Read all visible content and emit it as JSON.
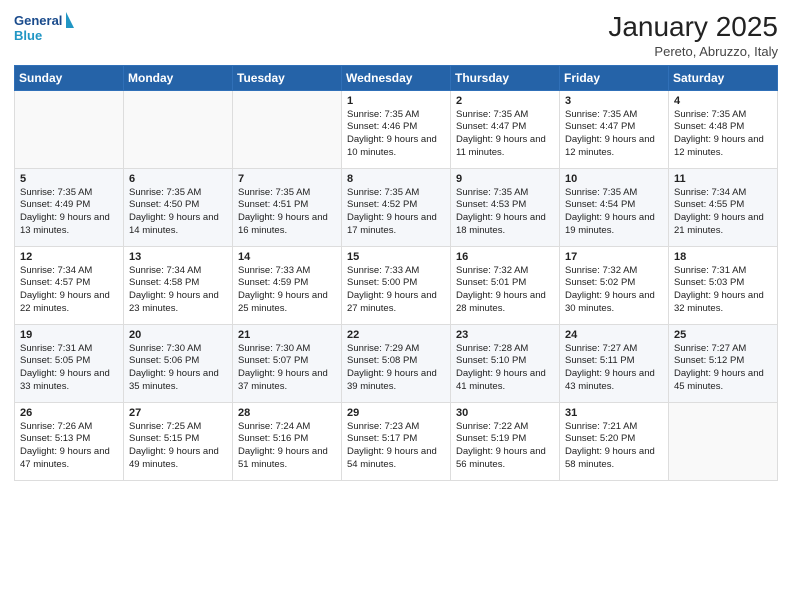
{
  "header": {
    "logo_line1": "General",
    "logo_line2": "Blue",
    "month": "January 2025",
    "location": "Pereto, Abruzzo, Italy"
  },
  "weekdays": [
    "Sunday",
    "Monday",
    "Tuesday",
    "Wednesday",
    "Thursday",
    "Friday",
    "Saturday"
  ],
  "weeks": [
    [
      {
        "day": "",
        "sunrise": "",
        "sunset": "",
        "daylight": ""
      },
      {
        "day": "",
        "sunrise": "",
        "sunset": "",
        "daylight": ""
      },
      {
        "day": "",
        "sunrise": "",
        "sunset": "",
        "daylight": ""
      },
      {
        "day": "1",
        "sunrise": "Sunrise: 7:35 AM",
        "sunset": "Sunset: 4:46 PM",
        "daylight": "Daylight: 9 hours and 10 minutes."
      },
      {
        "day": "2",
        "sunrise": "Sunrise: 7:35 AM",
        "sunset": "Sunset: 4:47 PM",
        "daylight": "Daylight: 9 hours and 11 minutes."
      },
      {
        "day": "3",
        "sunrise": "Sunrise: 7:35 AM",
        "sunset": "Sunset: 4:47 PM",
        "daylight": "Daylight: 9 hours and 12 minutes."
      },
      {
        "day": "4",
        "sunrise": "Sunrise: 7:35 AM",
        "sunset": "Sunset: 4:48 PM",
        "daylight": "Daylight: 9 hours and 12 minutes."
      }
    ],
    [
      {
        "day": "5",
        "sunrise": "Sunrise: 7:35 AM",
        "sunset": "Sunset: 4:49 PM",
        "daylight": "Daylight: 9 hours and 13 minutes."
      },
      {
        "day": "6",
        "sunrise": "Sunrise: 7:35 AM",
        "sunset": "Sunset: 4:50 PM",
        "daylight": "Daylight: 9 hours and 14 minutes."
      },
      {
        "day": "7",
        "sunrise": "Sunrise: 7:35 AM",
        "sunset": "Sunset: 4:51 PM",
        "daylight": "Daylight: 9 hours and 16 minutes."
      },
      {
        "day": "8",
        "sunrise": "Sunrise: 7:35 AM",
        "sunset": "Sunset: 4:52 PM",
        "daylight": "Daylight: 9 hours and 17 minutes."
      },
      {
        "day": "9",
        "sunrise": "Sunrise: 7:35 AM",
        "sunset": "Sunset: 4:53 PM",
        "daylight": "Daylight: 9 hours and 18 minutes."
      },
      {
        "day": "10",
        "sunrise": "Sunrise: 7:35 AM",
        "sunset": "Sunset: 4:54 PM",
        "daylight": "Daylight: 9 hours and 19 minutes."
      },
      {
        "day": "11",
        "sunrise": "Sunrise: 7:34 AM",
        "sunset": "Sunset: 4:55 PM",
        "daylight": "Daylight: 9 hours and 21 minutes."
      }
    ],
    [
      {
        "day": "12",
        "sunrise": "Sunrise: 7:34 AM",
        "sunset": "Sunset: 4:57 PM",
        "daylight": "Daylight: 9 hours and 22 minutes."
      },
      {
        "day": "13",
        "sunrise": "Sunrise: 7:34 AM",
        "sunset": "Sunset: 4:58 PM",
        "daylight": "Daylight: 9 hours and 23 minutes."
      },
      {
        "day": "14",
        "sunrise": "Sunrise: 7:33 AM",
        "sunset": "Sunset: 4:59 PM",
        "daylight": "Daylight: 9 hours and 25 minutes."
      },
      {
        "day": "15",
        "sunrise": "Sunrise: 7:33 AM",
        "sunset": "Sunset: 5:00 PM",
        "daylight": "Daylight: 9 hours and 27 minutes."
      },
      {
        "day": "16",
        "sunrise": "Sunrise: 7:32 AM",
        "sunset": "Sunset: 5:01 PM",
        "daylight": "Daylight: 9 hours and 28 minutes."
      },
      {
        "day": "17",
        "sunrise": "Sunrise: 7:32 AM",
        "sunset": "Sunset: 5:02 PM",
        "daylight": "Daylight: 9 hours and 30 minutes."
      },
      {
        "day": "18",
        "sunrise": "Sunrise: 7:31 AM",
        "sunset": "Sunset: 5:03 PM",
        "daylight": "Daylight: 9 hours and 32 minutes."
      }
    ],
    [
      {
        "day": "19",
        "sunrise": "Sunrise: 7:31 AM",
        "sunset": "Sunset: 5:05 PM",
        "daylight": "Daylight: 9 hours and 33 minutes."
      },
      {
        "day": "20",
        "sunrise": "Sunrise: 7:30 AM",
        "sunset": "Sunset: 5:06 PM",
        "daylight": "Daylight: 9 hours and 35 minutes."
      },
      {
        "day": "21",
        "sunrise": "Sunrise: 7:30 AM",
        "sunset": "Sunset: 5:07 PM",
        "daylight": "Daylight: 9 hours and 37 minutes."
      },
      {
        "day": "22",
        "sunrise": "Sunrise: 7:29 AM",
        "sunset": "Sunset: 5:08 PM",
        "daylight": "Daylight: 9 hours and 39 minutes."
      },
      {
        "day": "23",
        "sunrise": "Sunrise: 7:28 AM",
        "sunset": "Sunset: 5:10 PM",
        "daylight": "Daylight: 9 hours and 41 minutes."
      },
      {
        "day": "24",
        "sunrise": "Sunrise: 7:27 AM",
        "sunset": "Sunset: 5:11 PM",
        "daylight": "Daylight: 9 hours and 43 minutes."
      },
      {
        "day": "25",
        "sunrise": "Sunrise: 7:27 AM",
        "sunset": "Sunset: 5:12 PM",
        "daylight": "Daylight: 9 hours and 45 minutes."
      }
    ],
    [
      {
        "day": "26",
        "sunrise": "Sunrise: 7:26 AM",
        "sunset": "Sunset: 5:13 PM",
        "daylight": "Daylight: 9 hours and 47 minutes."
      },
      {
        "day": "27",
        "sunrise": "Sunrise: 7:25 AM",
        "sunset": "Sunset: 5:15 PM",
        "daylight": "Daylight: 9 hours and 49 minutes."
      },
      {
        "day": "28",
        "sunrise": "Sunrise: 7:24 AM",
        "sunset": "Sunset: 5:16 PM",
        "daylight": "Daylight: 9 hours and 51 minutes."
      },
      {
        "day": "29",
        "sunrise": "Sunrise: 7:23 AM",
        "sunset": "Sunset: 5:17 PM",
        "daylight": "Daylight: 9 hours and 54 minutes."
      },
      {
        "day": "30",
        "sunrise": "Sunrise: 7:22 AM",
        "sunset": "Sunset: 5:19 PM",
        "daylight": "Daylight: 9 hours and 56 minutes."
      },
      {
        "day": "31",
        "sunrise": "Sunrise: 7:21 AM",
        "sunset": "Sunset: 5:20 PM",
        "daylight": "Daylight: 9 hours and 58 minutes."
      },
      {
        "day": "",
        "sunrise": "",
        "sunset": "",
        "daylight": ""
      }
    ]
  ]
}
